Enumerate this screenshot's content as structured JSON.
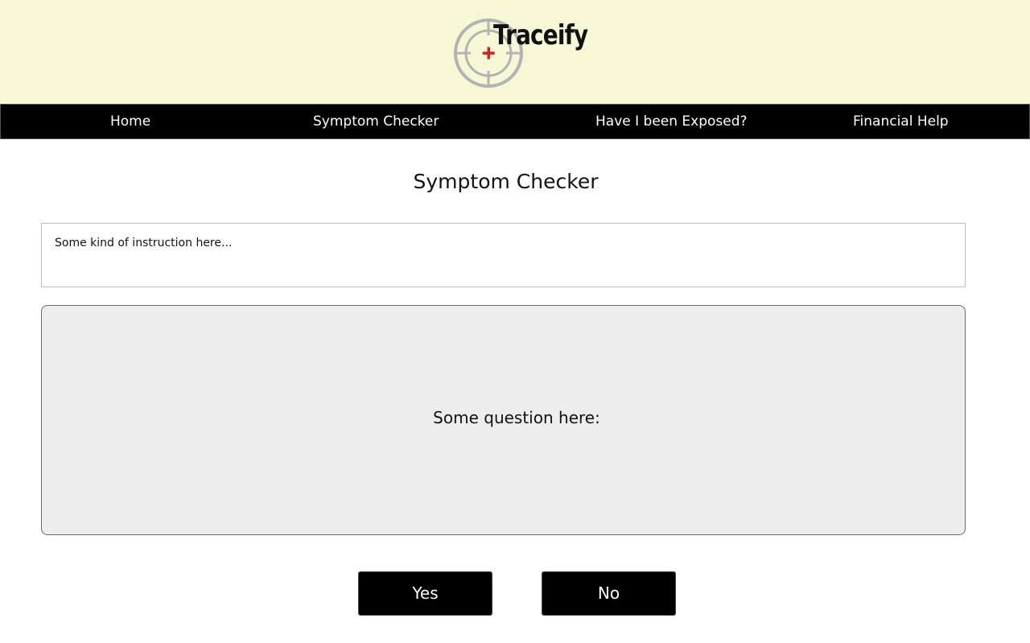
{
  "brand": {
    "name": "Traceify",
    "icon": "crosshair-cross-icon",
    "colors": {
      "header_bg": "#f7f7d6",
      "crosshair": "#b3b3b3",
      "cross": "#cc2222"
    }
  },
  "nav": {
    "items": [
      {
        "label": "Home"
      },
      {
        "label": "Symptom Checker"
      },
      {
        "label": "Have I been Exposed?"
      },
      {
        "label": "Financial Help"
      }
    ],
    "background": "#000000"
  },
  "main": {
    "title": "Symptom Checker",
    "instruction": "Some kind of instruction here...",
    "question": "Some question here:",
    "yes_label": "Yes",
    "no_label": "No"
  }
}
